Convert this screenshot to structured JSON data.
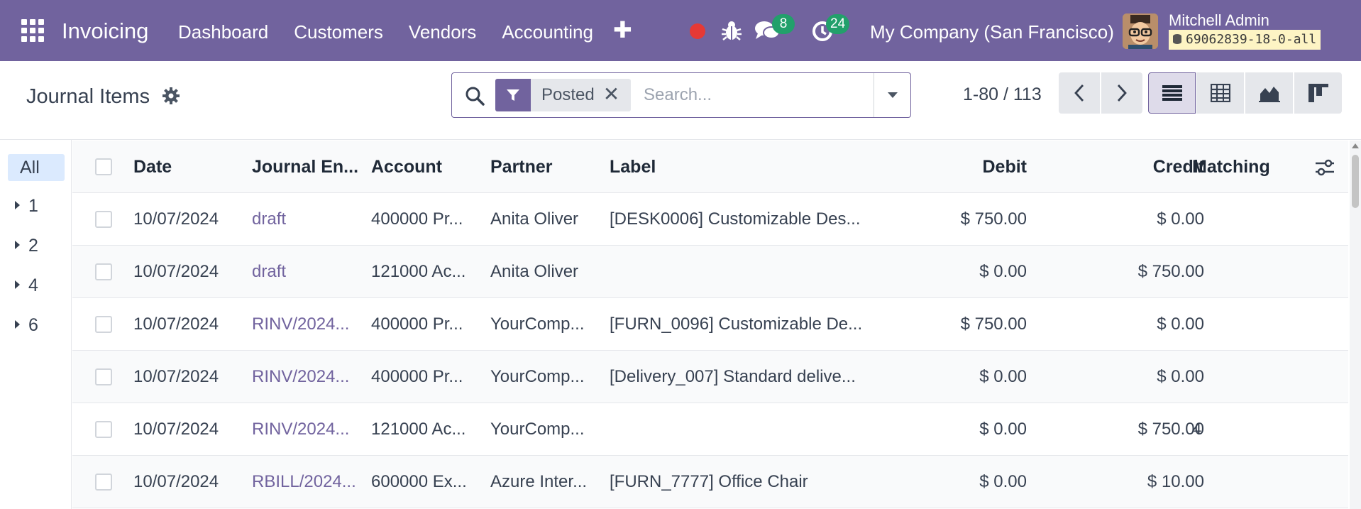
{
  "navbar": {
    "app_title": "Invoicing",
    "menu": [
      "Dashboard",
      "Customers",
      "Vendors",
      "Accounting"
    ],
    "messages_badge": "8",
    "activities_badge": "24",
    "company": "My Company (San Francisco)",
    "user_name": "Mitchell Admin",
    "database": "69062839-18-0-all",
    "colors": {
      "navbar_bg": "#71639e",
      "badge": "#22a06b",
      "record": "#e53935"
    }
  },
  "control_panel": {
    "title": "Journal Items",
    "facet_label": "Posted",
    "search_placeholder": "Search...",
    "pager": "1-80 / 113",
    "active_view": "list",
    "views": [
      "list",
      "pivot",
      "graph",
      "kanban"
    ]
  },
  "side_panel": {
    "all_label": "All",
    "items": [
      "1",
      "2",
      "4",
      "6"
    ]
  },
  "table": {
    "columns": [
      "Date",
      "Journal En...",
      "Account",
      "Partner",
      "Label",
      "Debit",
      "Credit",
      "Matching"
    ],
    "rows": [
      {
        "date": "10/07/2024",
        "journal": "draft",
        "account": "400000 Pr...",
        "partner": "Anita Oliver",
        "label": "[DESK0006] Customizable Des...",
        "debit": "$ 750.00",
        "credit": "$ 0.00",
        "matching": ""
      },
      {
        "date": "10/07/2024",
        "journal": "draft",
        "account": "121000 Ac...",
        "partner": "Anita Oliver",
        "label": "",
        "debit": "$ 0.00",
        "credit": "$ 750.00",
        "matching": ""
      },
      {
        "date": "10/07/2024",
        "journal": "RINV/2024...",
        "account": "400000 Pr...",
        "partner": "YourComp...",
        "label": "[FURN_0096] Customizable De...",
        "debit": "$ 750.00",
        "credit": "$ 0.00",
        "matching": ""
      },
      {
        "date": "10/07/2024",
        "journal": "RINV/2024...",
        "account": "400000 Pr...",
        "partner": "YourComp...",
        "label": "[Delivery_007] Standard delive...",
        "debit": "$ 0.00",
        "credit": "$ 0.00",
        "matching": ""
      },
      {
        "date": "10/07/2024",
        "journal": "RINV/2024...",
        "account": "121000 Ac...",
        "partner": "YourComp...",
        "label": "",
        "debit": "$ 0.00",
        "credit": "$ 750.00",
        "matching": "4"
      },
      {
        "date": "10/07/2024",
        "journal": "RBILL/2024...",
        "account": "600000 Ex...",
        "partner": "Azure Inter...",
        "label": "[FURN_7777] Office Chair",
        "debit": "$ 0.00",
        "credit": "$ 10.00",
        "matching": ""
      }
    ]
  }
}
